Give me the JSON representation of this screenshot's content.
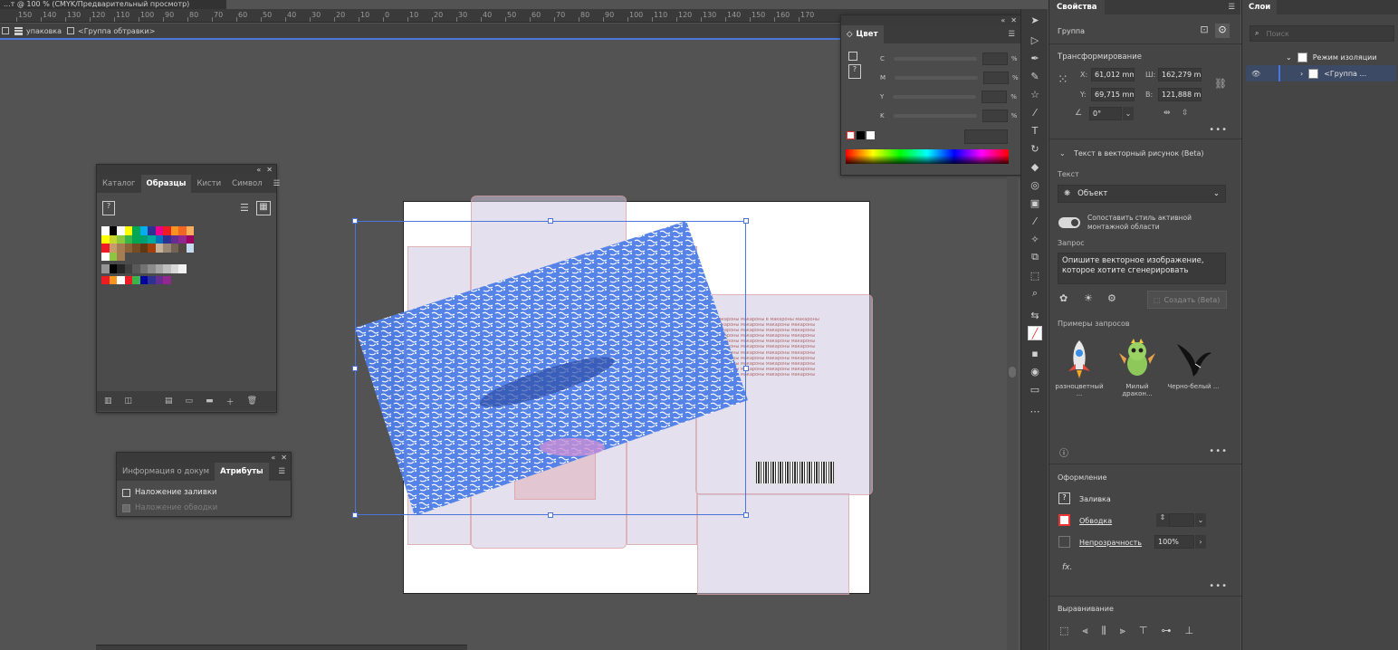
{
  "document_tab": "...т @ 100 % (CMYK/Предварительный просмотр)",
  "ruler_ticks": [
    "150",
    "140",
    "130",
    "120",
    "110",
    "100",
    "90",
    "80",
    "70",
    "60",
    "50",
    "40",
    "30",
    "20",
    "10",
    "0",
    "10",
    "20",
    "30",
    "40",
    "50",
    "60",
    "70",
    "80",
    "90",
    "100",
    "110",
    "120",
    "130",
    "140",
    "150",
    "160",
    "170"
  ],
  "control_bar": {
    "layer_name": "упаковка",
    "group_label": "<Группа обтравки>"
  },
  "swatches_panel": {
    "tabs": [
      "Каталог",
      "Образцы",
      "Кисти",
      "Символ"
    ],
    "active_tab": "Образцы",
    "rows": [
      [
        "#ffffff",
        "#000000",
        "#ffffff",
        "#ffff00",
        "#00a651",
        "#00aeef",
        "#2e3192",
        "#ec008c",
        "#ed1c24",
        "#f7941d",
        "#f26522",
        "#fbaf5d"
      ],
      [
        "#ffff00",
        "#c6d631",
        "#8dc63f",
        "#39b54a",
        "#00a651",
        "#009e73",
        "#00a99d",
        "#0072bc",
        "#2e3192",
        "#662d91",
        "#92278f",
        "#9e005d"
      ],
      [
        "#ed1c24",
        "#c69c6d",
        "#a67c52",
        "#8c6239",
        "#754c24",
        "#603913",
        "#a0410d",
        "#c7b299",
        "#998675",
        "#736357",
        "#534741",
        "#c2dcf2"
      ],
      [
        "#ffffff",
        "#8dc63f",
        "#a67c52"
      ],
      [
        "#959595",
        "#000000",
        "#262626",
        "#404040",
        "#595959",
        "#737373",
        "#8c8c8c",
        "#a6a6a6",
        "#bfbfbf",
        "#d9d9d9",
        "#f2f2f2"
      ],
      [
        "#ed1c24",
        "#f7941d",
        "#ffffff",
        "#ed1c24",
        "#39b54a",
        "#0000a0",
        "#2e3192",
        "#662d91",
        "#92278f"
      ]
    ]
  },
  "attributes_panel": {
    "tabs": [
      "Информация о докум",
      "Атрибуты"
    ],
    "active_tab": "Атрибуты",
    "overprint_fill": "Наложение заливки",
    "overprint_stroke": "Наложение обводки"
  },
  "color_panel": {
    "title": "Цвет",
    "channels": [
      "C",
      "M",
      "Y",
      "K"
    ],
    "percent": "%"
  },
  "product_text": "макароны макароны в макароны макароны макароны макароны макароны макароны макароны макароны макароны макароны макароны макароны макароны макароны макароны макароны макароны макароны макароны макароны макароны макароны макароны макароны макароны макароны макароны макароны макароны макароны макароны макароны макароны макароны макароны макароны макароны макароны макароны макароны макароны макароны",
  "properties": {
    "tab": "Свойства",
    "object_type": "Группа",
    "transform_title": "Трансформирование",
    "x_label": "X:",
    "x_value": "61,012 mm",
    "y_label": "Y:",
    "y_value": "69,715 mm",
    "w_label": "Ш:",
    "w_value": "162,279 mr",
    "h_label": "В:",
    "h_value": "121,888 mr",
    "angle_value": "0°",
    "t2v_title": "Текст в векторный рисунок (Beta)",
    "text_label": "Текст",
    "text_dropdown": "Объект",
    "match_style": "Сопоставить стиль активной монтажной области",
    "prompt_label": "Запрос",
    "prompt_placeholder": "Опишите векторное изображение, которое хотите сгенерировать",
    "generate_button": "Создать (Beta)",
    "examples_title": "Примеры запросов",
    "examples": [
      "разноцветный ...",
      "Милый дракон...",
      "Черно-белый ..."
    ],
    "appearance_title": "Оформление",
    "fill_label": "Заливка",
    "stroke_label": "Обводка",
    "opacity_label": "Непрозрачность",
    "opacity_value": "100%",
    "fx_label": "fx.",
    "align_title": "Выравнивание"
  },
  "layers": {
    "tab": "Слои",
    "search_placeholder": "Поиск",
    "isolation_mode": "Режим изоляции",
    "group_item": "<Группа ..."
  },
  "colors": {
    "selection_blue": "#4a76d9",
    "art_blue": "#4f7ee8",
    "panel_bg": "#454545",
    "canvas_bg": "#535353"
  }
}
